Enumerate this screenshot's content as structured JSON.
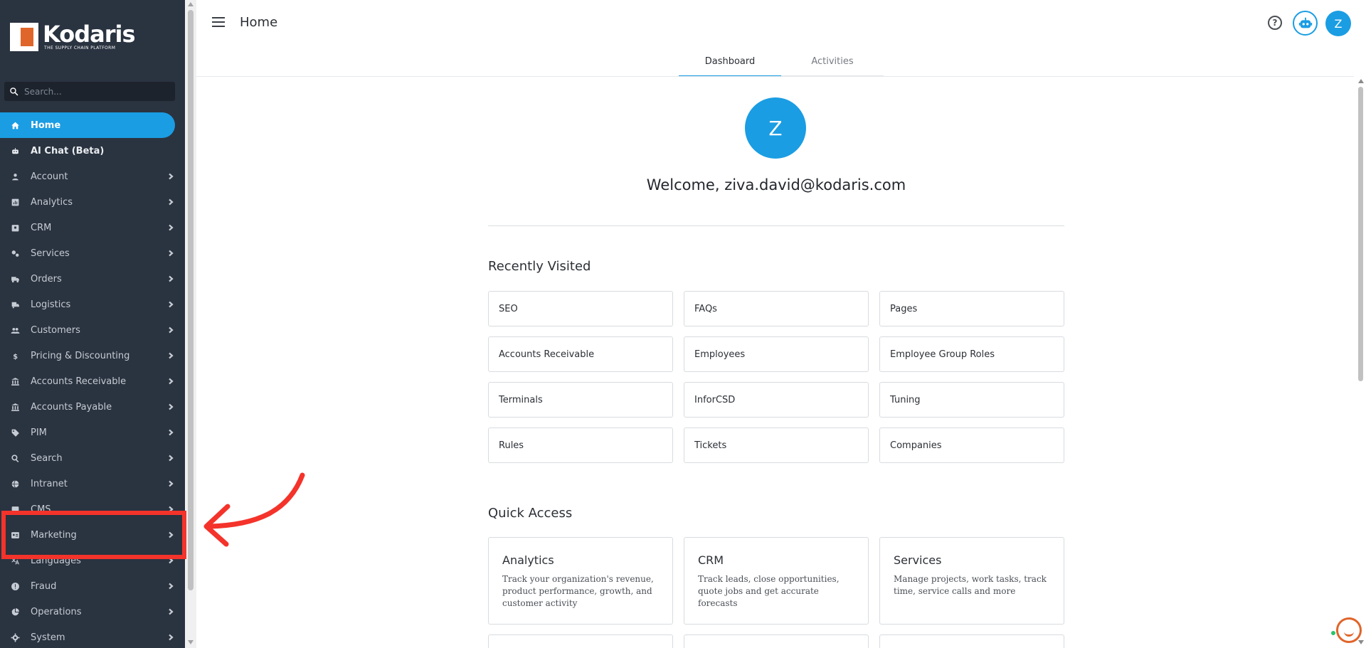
{
  "app": {
    "logo_name": "Kodaris",
    "logo_tagline": "THE SUPPLY CHAIN PLATFORM",
    "accent_color": "#1a9de3",
    "brand_color": "#e0652a"
  },
  "sidebar": {
    "search_placeholder": "Search...",
    "items": [
      {
        "label": "Home",
        "icon": "home-icon",
        "active": true,
        "chevron": false
      },
      {
        "label": "AI Chat (Beta)",
        "icon": "robot-icon",
        "chevron": false
      },
      {
        "label": "Account",
        "icon": "person-icon",
        "chevron": true
      },
      {
        "label": "Analytics",
        "icon": "analytics-icon",
        "chevron": true
      },
      {
        "label": "CRM",
        "icon": "contact-card-icon",
        "chevron": true
      },
      {
        "label": "Services",
        "icon": "gears-icon",
        "chevron": true
      },
      {
        "label": "Orders",
        "icon": "truck-icon",
        "chevron": true
      },
      {
        "label": "Logistics",
        "icon": "shipping-icon",
        "chevron": true
      },
      {
        "label": "Customers",
        "icon": "people-icon",
        "chevron": true
      },
      {
        "label": "Pricing & Discounting",
        "icon": "dollar-icon",
        "chevron": true
      },
      {
        "label": "Accounts Receivable",
        "icon": "bank-icon",
        "chevron": true
      },
      {
        "label": "Accounts Payable",
        "icon": "bank-icon",
        "chevron": true
      },
      {
        "label": "PIM",
        "icon": "tag-icon",
        "chevron": true
      },
      {
        "label": "Search",
        "icon": "search-icon",
        "chevron": true
      },
      {
        "label": "Intranet",
        "icon": "globe-icon",
        "chevron": true
      },
      {
        "label": "CMS",
        "icon": "cms-icon",
        "chevron": true
      },
      {
        "label": "Marketing",
        "icon": "id-card-icon",
        "chevron": true
      },
      {
        "label": "Languages",
        "icon": "translate-icon",
        "chevron": true
      },
      {
        "label": "Fraud",
        "icon": "alert-icon",
        "chevron": true
      },
      {
        "label": "Operations",
        "icon": "pie-icon",
        "chevron": true
      },
      {
        "label": "System",
        "icon": "gear-icon",
        "chevron": true
      }
    ]
  },
  "header": {
    "title": "Home",
    "user_initial": "Z"
  },
  "tabs": [
    {
      "label": "Dashboard",
      "active": true
    },
    {
      "label": "Activities",
      "active": false
    }
  ],
  "main": {
    "avatar_initial": "Z",
    "welcome": "Welcome, ziva.david@kodaris.com",
    "recently_visited_title": "Recently Visited",
    "recently_visited": [
      "SEO",
      "FAQs",
      "Pages",
      "Accounts Receivable",
      "Employees",
      "Employee Group Roles",
      "Terminals",
      "InforCSD",
      "Tuning",
      "Rules",
      "Tickets",
      "Companies"
    ],
    "quick_access_title": "Quick Access",
    "quick_access": [
      {
        "title": "Analytics",
        "desc": "Track your organization's revenue, product performance, growth, and customer activity"
      },
      {
        "title": "CRM",
        "desc": "Track leads, close opportunities, quote jobs and get accurate forecasts"
      },
      {
        "title": "Services",
        "desc": "Manage projects, work tasks, track time, service calls and more"
      }
    ]
  }
}
